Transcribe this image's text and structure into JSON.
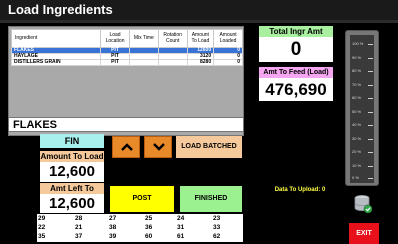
{
  "window": {
    "title": "Load Ingredients"
  },
  "table": {
    "headers": [
      "Ingredient",
      "Load Location",
      "Mix Time",
      "Rotation Count",
      "Amount To Load",
      "Amount Loaded"
    ],
    "rows": [
      {
        "ingredient": "FLAKES",
        "location": "PIT",
        "mix_time": "",
        "rotation": "",
        "to_load": "12600",
        "loaded": "0",
        "selected": true
      },
      {
        "ingredient": "HAYLAGE",
        "location": "PIT",
        "mix_time": "",
        "rotation": "",
        "to_load": "3120",
        "loaded": "0",
        "selected": false
      },
      {
        "ingredient": "DISTILLERS GRAIN",
        "location": "PIT",
        "mix_time": "",
        "rotation": "",
        "to_load": "8280",
        "loaded": "0",
        "selected": false
      }
    ]
  },
  "selected_ingredient": "FLAKES",
  "fin_label": "FIN",
  "amount_to_load": {
    "label": "Amount To Load",
    "value": "12,600"
  },
  "amount_left_to_load": {
    "label": "Amt Left To Load",
    "value": "12,600"
  },
  "buttons": {
    "up_icon": "chevron-up-icon",
    "down_icon": "chevron-down-icon",
    "load_batched": "LOAD BATCHED",
    "post": "POST",
    "finished": "FINISHED",
    "exit": "EXIT"
  },
  "number_grid": [
    [
      "29",
      "28",
      "27",
      "25",
      "24",
      "23"
    ],
    [
      "22",
      "21",
      "38",
      "36",
      "31",
      "33"
    ],
    [
      "35",
      "37",
      "39",
      "60",
      "61",
      "62"
    ]
  ],
  "total_ingr": {
    "label": "Total Ingr Amt",
    "value": "0"
  },
  "amt_to_feed": {
    "label": "Amt To Feed (Load)",
    "value": "476,690"
  },
  "upload": {
    "text": "Data To Upload: 0"
  },
  "gauge": {
    "ticks": [
      "100 %",
      "90 %",
      "80 %",
      "70 %",
      "60 %",
      "50 %",
      "40 %",
      "30 %",
      "20 %",
      "10 %",
      "0 %"
    ]
  },
  "colors": {
    "selected_row": "#3a73d6",
    "fin": "#a8f0ee",
    "label_peach": "#f5c99b",
    "arrow_orange": "#e88a2a",
    "post_yellow": "#ffff00",
    "finished_green": "#9bf08f",
    "total_green": "#a8f0a0",
    "feed_pink": "#f4a6f0",
    "exit_red": "#e8101a",
    "upload_text": "#ffff44"
  }
}
